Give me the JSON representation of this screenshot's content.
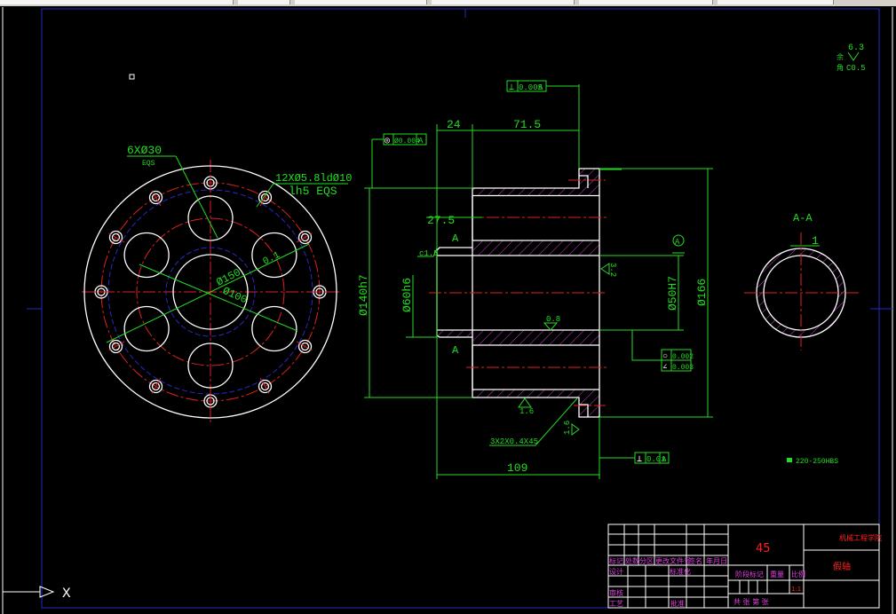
{
  "colors": {
    "dimension": "#22dd22",
    "outline": "#ffffff",
    "centerline": "#e02020",
    "border": "#2828c8",
    "hatch": "#c040c0",
    "title_text": "#ff2020",
    "table_label": "#e040e0"
  },
  "front_view": {
    "holes_note": "6XØ30",
    "holes_note_sub": "EQS",
    "bolt_note": "12XØ5.8ldØ10",
    "bolt_note_sub": "lh5 EQS",
    "dia_150": "Ø150",
    "dia_100": "Ø100",
    "position_tol": "0.1",
    "bolt_hole_count": 12,
    "large_hole_count": 6
  },
  "section_view": {
    "dim_24": "24",
    "dim_71_5": "71.5",
    "dim_27_5": "27.5",
    "dim_109": "109",
    "dia_140": "Ø140h7",
    "dia_60": "Ø60h6",
    "dia_50": "Ø50H7",
    "dia_166": "Ø166",
    "chamfer": "c1.5",
    "section_mark": "A",
    "datum": "A",
    "rough_08": "0.8",
    "rough_32": "3.2",
    "rough_16a": "1.6",
    "rough_16b": "1.6",
    "groove_note": "3X2X0.4X45",
    "tol_perp_top": {
      "symbol": "⊥",
      "value": "0.005",
      "datum": "A"
    },
    "tol_concentric": {
      "symbol": "◎",
      "value": "Ø0.004",
      "datum": "A"
    },
    "tol_round": {
      "symbol": "○",
      "value": "0.002"
    },
    "tol_cyl": {
      "symbol": "∠",
      "value": "0.003"
    },
    "tol_perp_bottom": {
      "symbol": "⊥",
      "value": "0.01",
      "datum": "A"
    }
  },
  "aa_view": {
    "title": "A-A",
    "dim": "1"
  },
  "notes": {
    "roughness_value": "6.3",
    "roughness_label": "余",
    "chamfer_label": "角",
    "chamfer_value": "C0.5",
    "hardness": "220-250HBS"
  },
  "ucs": {
    "x_label": "X"
  },
  "title_block": {
    "header_cols": [
      "标记",
      "处数",
      "分区",
      "更改文件号",
      "签名",
      "年月日"
    ],
    "design": "设计",
    "standardize": "标准化",
    "review": "审核",
    "process": "工艺",
    "approve": "批准",
    "stage_mark": "阶段标记",
    "weight": "重量",
    "scale_label": "比例",
    "scale_value": "1:1",
    "sheets": "共   张  第   张",
    "material": "45",
    "school": "机械工程学院",
    "part_name": "假轴"
  }
}
